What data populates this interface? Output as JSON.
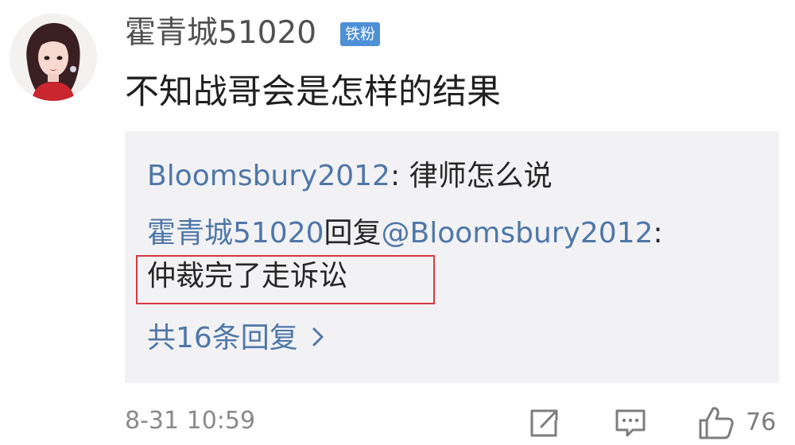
{
  "post": {
    "author": "霍青城51020",
    "badge": "铁粉",
    "content": "不知战哥会是怎样的结果"
  },
  "replies": [
    {
      "author": "Bloomsbury2012",
      "separator": ":",
      "text": "律师怎么说"
    },
    {
      "author": "霍青城51020",
      "reply_word": "回复",
      "target": "@Bloomsbury2012",
      "separator": ":",
      "text": "仲裁完了走诉讼"
    }
  ],
  "more_replies": "共16条回复",
  "footer": {
    "timestamp": "8-31 10:59",
    "like_count": "76"
  },
  "icons": {
    "share": "share-icon",
    "comment": "comment-icon",
    "like": "thumbs-up-icon",
    "chevron": "chevron-right-icon"
  },
  "colors": {
    "link": "#4f77a8",
    "badge": "#4e8fd6",
    "highlight": "#d8373f",
    "reply_background": "#f2f2f4"
  }
}
